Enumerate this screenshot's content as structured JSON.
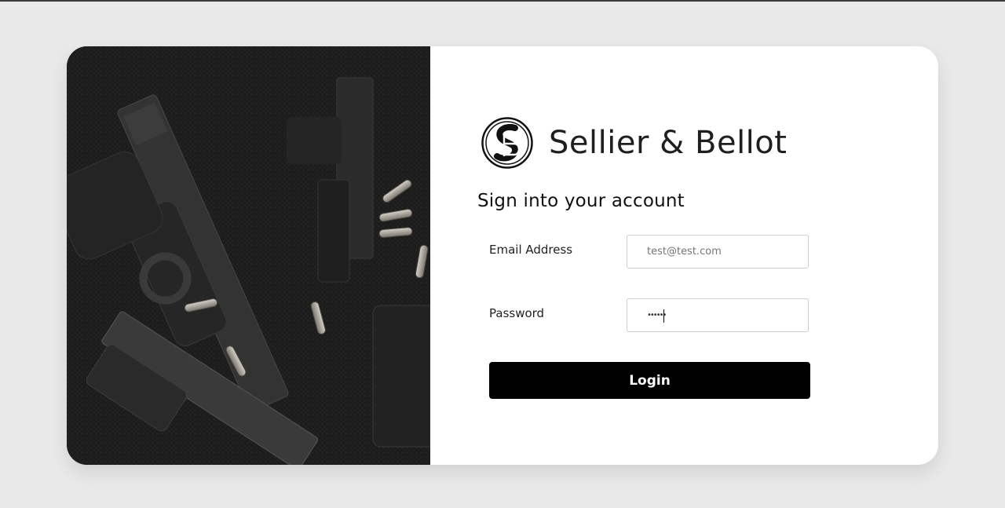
{
  "brand": {
    "name": "Sellier & Bellot",
    "logo_icon": "sb-monogram-logo"
  },
  "form": {
    "heading": "Sign into your account",
    "email": {
      "label": "Email Address",
      "placeholder": "test@test.com",
      "value": ""
    },
    "password": {
      "label": "Password",
      "value": "••••••"
    },
    "login_label": "Login"
  },
  "hero": {
    "image": "handguns-and-cartridges-photo"
  },
  "colors": {
    "page_background": "#e9e9e9",
    "card_background": "#ffffff",
    "button_background": "#000000",
    "button_text": "#ffffff"
  }
}
